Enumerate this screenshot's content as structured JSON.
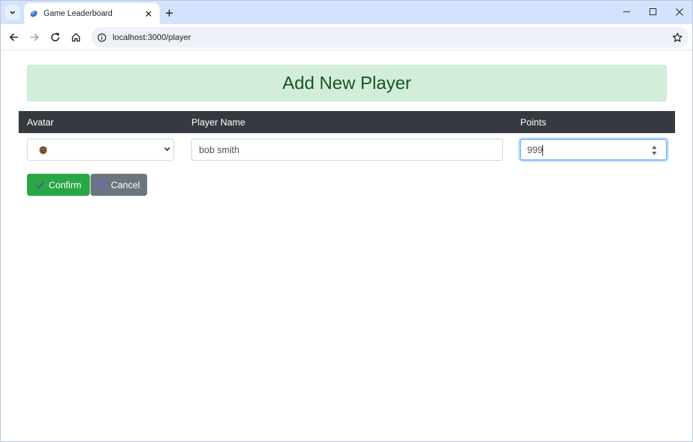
{
  "browser": {
    "tab_title": "Game Leaderboard",
    "url": "localhost:3000/player",
    "colors": {
      "tabstrip": "#d3e3fd",
      "omnibox": "#eef1f7"
    }
  },
  "page": {
    "heading": "Add New Player",
    "table": {
      "headers": [
        "Avatar",
        "Player Name",
        "Points"
      ]
    },
    "form": {
      "avatar_selected_icon": "face-avatar-icon",
      "player_name_value": "bob smith",
      "points_value": "999"
    },
    "buttons": {
      "confirm_label": "Confirm",
      "cancel_label": "Cancel"
    },
    "colors": {
      "alert_bg": "#d4edda",
      "alert_text": "#155724",
      "header_bg": "#343a40",
      "confirm_bg": "#28a745",
      "cancel_bg": "#6c757d"
    }
  }
}
